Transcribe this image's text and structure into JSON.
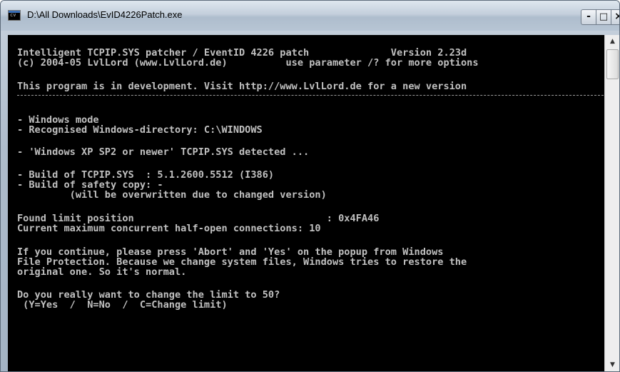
{
  "window": {
    "title": "D:\\All Downloads\\EvID4226Patch.exe"
  },
  "titlebar": {
    "app_icon": "console-icon",
    "app_icon_glyph": "cv",
    "minimize_icon": "minimize-icon",
    "minimize_glyph": "-",
    "maximize_icon": "maximize-icon",
    "maximize_glyph": "□",
    "close_icon": "close-icon",
    "close_glyph": "×"
  },
  "console": {
    "lines": [
      "Intelligent TCPIP.SYS patcher / EventID 4226 patch              Version 2.23d",
      "(c) 2004-05 LvlLord (www.LvlLord.de)          use parameter /? for more options",
      "This program is in development. Visit http://www.LvlLord.de for a new version",
      "- Windows mode",
      "- Recognised Windows-directory: C:\\WINDOWS",
      "- 'Windows XP SP2 or newer' TCPIP.SYS detected ...",
      "- Build of TCPIP.SYS  : 5.1.2600.5512 (I386)",
      "- Build of safety copy: -",
      "         (will be overwritten due to changed version)",
      "Found limit position                                 : 0x4FA46",
      "Current maximum concurrent half-open connections: 10",
      "If you continue, please press 'Abort' and 'Yes' on the popup from Windows",
      "File Protection. Because we change system files, Windows tries to restore the",
      "original one. So it's normal.",
      "Do you really want to change the limit to 50?",
      " (Y=Yes  /  N=No  /  C=Change limit)"
    ]
  },
  "scrollbar": {
    "up_icon": "scroll-up-arrow-icon",
    "up_glyph": "▲",
    "down_icon": "scroll-down-arrow-icon",
    "down_glyph": "▼"
  },
  "colors": {
    "console_background": "#000000",
    "console_text": "#c0c0c0"
  }
}
